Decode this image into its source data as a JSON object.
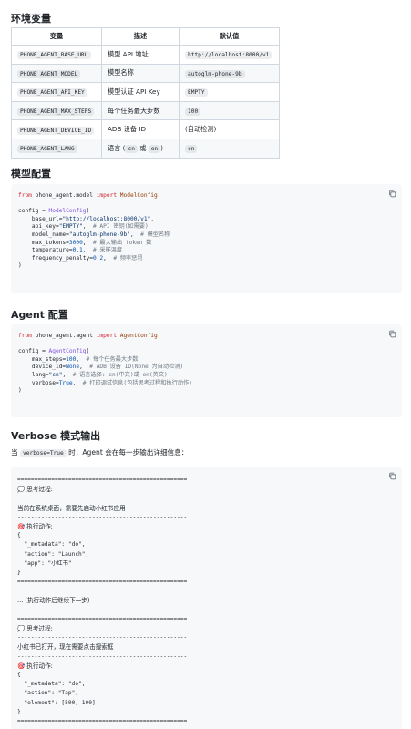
{
  "sections": {
    "env_title": "环境变量",
    "model_title": "模型配置",
    "agent_title": "Agent 配置",
    "verbose_title": "Verbose 模式输出"
  },
  "env_table": {
    "headers": [
      "变量",
      "描述",
      "默认值"
    ],
    "rows": [
      {
        "var": "PHONE_AGENT_BASE_URL",
        "desc": "模型 API 地址",
        "default": "http://localhost:8000/v1",
        "default_is_code": true
      },
      {
        "var": "PHONE_AGENT_MODEL",
        "desc": "模型名称",
        "default": "autoglm-phone-9b",
        "default_is_code": true
      },
      {
        "var": "PHONE_AGENT_API_KEY",
        "desc": "模型认证 API Key",
        "default": "EMPTY",
        "default_is_code": true
      },
      {
        "var": "PHONE_AGENT_MAX_STEPS",
        "desc": "每个任务最大步数",
        "default": "100",
        "default_is_code": true
      },
      {
        "var": "PHONE_AGENT_DEVICE_ID",
        "desc": "ADB 设备 ID",
        "default": "(自动检测)",
        "default_is_code": false
      },
      {
        "var": "PHONE_AGENT_LANG",
        "desc_pre": "语言 (",
        "desc_code1": "cn",
        "desc_mid": " 或 ",
        "desc_code2": "en",
        "desc_post": ")",
        "default": "cn",
        "default_is_code": true
      }
    ]
  },
  "model_code": {
    "l1_kw1": "from",
    "l1_mod": " phone_agent.model ",
    "l1_kw2": "import",
    "l1_cls": " ModelConfig",
    "l3_a": "config = ",
    "l3_fn": "ModelConfig",
    "p1_k": "    base_url=",
    "p1_v": "\"http://localhost:8000/v1\"",
    "p2_k": "    api_key=",
    "p2_v": "\"EMPTY\"",
    "p2_c": "  # API 密钥(如需要)",
    "p3_k": "    model_name=",
    "p3_v": "\"autoglm-phone-9b\"",
    "p3_c": "  # 模型名称",
    "p4_k": "    max_tokens=",
    "p4_v": "3000",
    "p4_c": "  # 最大输出 token 数",
    "p5_k": "    temperature=",
    "p5_v": "0.1",
    "p5_c": "  # 采样温度",
    "p6_k": "    frequency_penalty=",
    "p6_v": "0.2",
    "p6_c": "  # 频率惩罚",
    "close": ")"
  },
  "agent_code": {
    "l1_kw1": "from",
    "l1_mod": " phone_agent.agent ",
    "l1_kw2": "import",
    "l1_cls": " AgentConfig",
    "l3_a": "config = ",
    "l3_fn": "AgentConfig",
    "p1_k": "    max_steps=",
    "p1_v": "100",
    "p1_c": "  # 每个任务最大步数",
    "p2_k": "    device_id=",
    "p2_v": "None",
    "p2_c": "  # ADB 设备 ID(None 为自动检测)",
    "p3_k": "    lang=",
    "p3_v": "\"cn\"",
    "p3_c": "  # 语言选择: cn(中文)或 en(英文)",
    "p4_k": "    verbose=",
    "p4_v": "True",
    "p4_c": "  # 打印调试信息(包括思考过程和执行动作)",
    "close": ")"
  },
  "verbose_para": {
    "pre": "当 ",
    "code": "verbose=True",
    "post": " 时，Agent 会在每一步输出详细信息："
  },
  "verbose_log": [
    "==================================================",
    "💭 思考过程:",
    "--------------------------------------------------",
    "当前在系统桌面，需要先启动小红书应用",
    "--------------------------------------------------",
    "🎯 执行动作:",
    "{",
    "  \"_metadata\": \"do\",",
    "  \"action\": \"Launch\",",
    "  \"app\": \"小红书\"",
    "}",
    "==================================================",
    "",
    "... (执行动作后继续下一步)",
    "",
    "==================================================",
    "💭 思考过程:",
    "--------------------------------------------------",
    "小红书已打开，现在需要点击搜索框",
    "--------------------------------------------------",
    "🎯 执行动作:",
    "{",
    "  \"_metadata\": \"do\",",
    "  \"action\": \"Tap\",",
    "  \"element\": [500, 100]",
    "}",
    "=================================================="
  ],
  "colors": {
    "keyword": "#cf222e",
    "function": "#8250df",
    "string": "#0a3069",
    "number": "#0550ae",
    "comment": "#6e7781",
    "code_bg": "#f6f8fa"
  },
  "icons": {
    "copy": "copy-icon"
  }
}
